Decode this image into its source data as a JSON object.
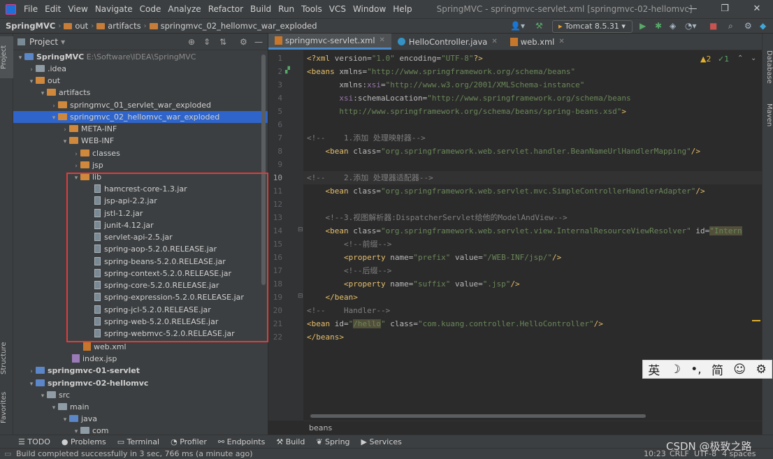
{
  "window": {
    "title": "SpringMVC - springmvc-servlet.xml [springmvc-02-hellomvc]",
    "minimize": "—",
    "maximize": "❐",
    "close": "✕"
  },
  "menu": [
    "File",
    "Edit",
    "View",
    "Navigate",
    "Code",
    "Analyze",
    "Refactor",
    "Build",
    "Run",
    "Tools",
    "VCS",
    "Window",
    "Help"
  ],
  "nav": {
    "crumbs": [
      "SpringMVC",
      "out",
      "artifacts",
      "springmvc_02_hellomvc_war_exploded"
    ],
    "run_config": "Tomcat 8.5.31"
  },
  "project_panel": {
    "title": "Project",
    "vtab_project": "Project",
    "vtab_structure": "Structure",
    "vtab_favorites": "Favorites"
  },
  "tree": {
    "root": "SpringMVC",
    "root_path": "E:\\Software\\IDEA\\SpringMVC",
    "idea": ".idea",
    "out": "out",
    "artifacts": "artifacts",
    "art1": "springmvc_01_servlet_war_exploded",
    "art2": "springmvc_02_hellomvc_war_exploded",
    "meta": "META-INF",
    "webinf": "WEB-INF",
    "classes": "classes",
    "jsp": "jsp",
    "lib": "lib",
    "jars": [
      "hamcrest-core-1.3.jar",
      "jsp-api-2.2.jar",
      "jstl-1.2.jar",
      "junit-4.12.jar",
      "servlet-api-2.5.jar",
      "spring-aop-5.2.0.RELEASE.jar",
      "spring-beans-5.2.0.RELEASE.jar",
      "spring-context-5.2.0.RELEASE.jar",
      "spring-core-5.2.0.RELEASE.jar",
      "spring-expression-5.2.0.RELEASE.jar",
      "spring-jcl-5.2.0.RELEASE.jar",
      "spring-web-5.2.0.RELEASE.jar",
      "spring-webmvc-5.2.0.RELEASE.jar"
    ],
    "webxml": "web.xml",
    "index": "index.jsp",
    "mod1": "springmvc-01-servlet",
    "mod2": "springmvc-02-hellomvc",
    "src": "src",
    "main": "main",
    "java": "java",
    "com": "com"
  },
  "editor": {
    "tabs": [
      "springmvc-servlet.xml",
      "HelloController.java",
      "web.xml"
    ],
    "warnings": "2",
    "checks": "1",
    "breadcrumb": "beans"
  },
  "right_strip": {
    "database": "Database",
    "maven": "Maven"
  },
  "bottom_tabs": [
    "TODO",
    "Problems",
    "Terminal",
    "Profiler",
    "Endpoints",
    "Build",
    "Spring",
    "Services"
  ],
  "status": {
    "message": "Build completed successfully in 3 sec, 766 ms (a minute ago)",
    "position": "10:23",
    "line_sep": "CRLF",
    "encoding": "UTF-8",
    "indent": "4 spaces"
  },
  "ime": {
    "lang": "英",
    "moon": "☽",
    "punct": "•,",
    "simp": "简",
    "smile": "☺",
    "gear": "⚙"
  },
  "watermark": "CSDN @极致之路"
}
